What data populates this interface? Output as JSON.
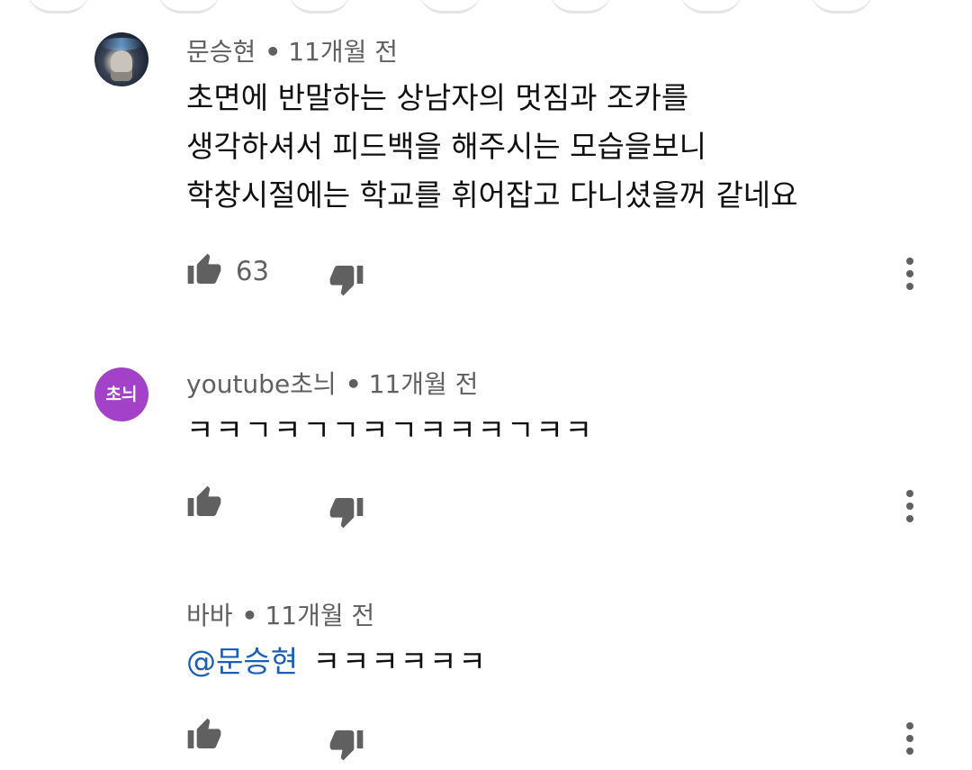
{
  "comments": [
    {
      "author": "문승현",
      "separator": "•",
      "time": "11개월 전",
      "lines": [
        "초면에 반말하는 상남자의 멋짐과 조카를",
        "생각하셔서 피드백을 해주시는 모습을보니",
        "학창시절에는 학교를 휘어잡고 다니셨을꺼 같네요"
      ],
      "likes": "63",
      "avatar": "profile-photo"
    },
    {
      "author": "youtube초늬",
      "separator": "•",
      "time": "11개월 전",
      "text": "ㅋㅋㄱㅋㄱㄱㅋㄱㅋㅋㅋㄱㅋㅋ",
      "avatar_text": "초늬",
      "avatar_color": "#a342c9"
    },
    {
      "author": "바바",
      "separator": "•",
      "time": "11개월 전",
      "mention": "@문승현",
      "text": "ㅋㅋㅋㅋㅋㅋ"
    }
  ],
  "icons": {
    "like": "thumbs-up-icon",
    "dislike": "thumbs-down-icon",
    "more": "more-vert-icon"
  },
  "colors": {
    "meta_text": "#606060",
    "body_text": "#0f0f0f",
    "mention": "#1a5fb4",
    "avatar_purple": "#a342c9",
    "icon": "#606060"
  }
}
